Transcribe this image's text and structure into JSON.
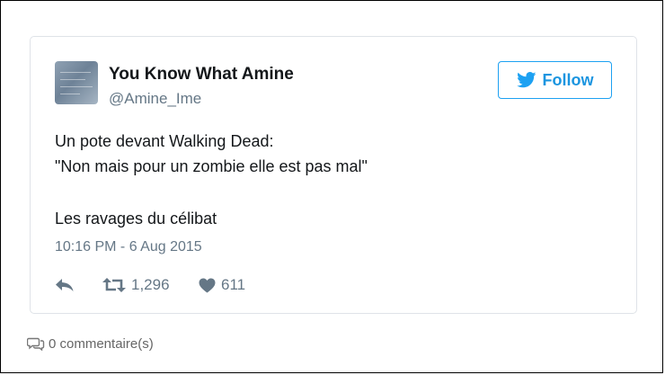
{
  "tweet": {
    "author_name": "You Know What Amine",
    "author_handle": "@Amine_Ime",
    "follow_label": "Follow",
    "lines": [
      "Un pote devant Walking Dead:",
      "\"Non mais pour un zombie elle est pas mal\"",
      "Les ravages du célibat"
    ],
    "timestamp": "10:16 PM - 6 Aug 2015",
    "retweets": "1,296",
    "likes": "611",
    "icons": {
      "reply": "reply-icon",
      "retweet": "retweet-icon",
      "like": "heart-icon",
      "follow": "twitter-bird-icon"
    },
    "colors": {
      "accent": "#1da1f2",
      "text": "#14171a",
      "muted": "#657786"
    }
  },
  "footer": {
    "comments_label": "0 commentaire(s)"
  }
}
